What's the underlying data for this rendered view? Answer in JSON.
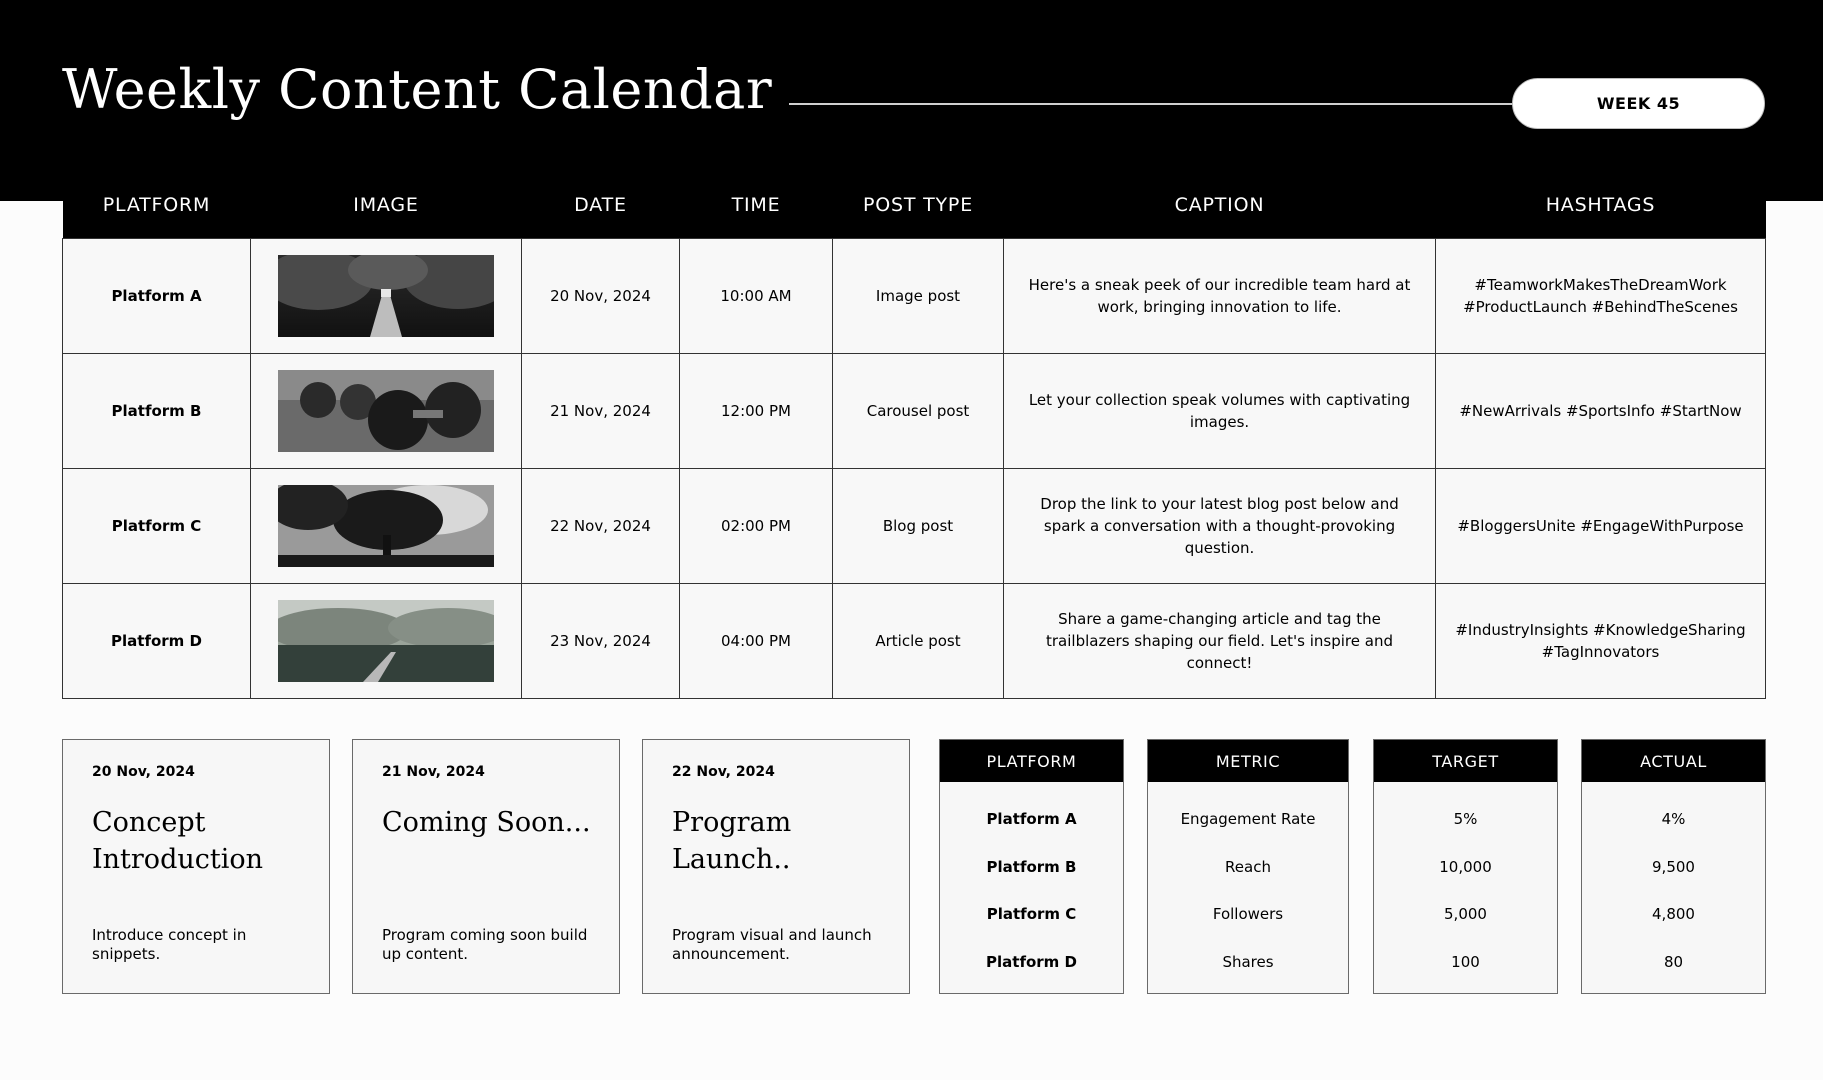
{
  "header": {
    "title": "Weekly Content Calendar",
    "week": "WEEK 45"
  },
  "table": {
    "columns": [
      "PLATFORM",
      "IMAGE",
      "DATE",
      "TIME",
      "POST TYPE",
      "CAPTION",
      "HASHTAGS"
    ],
    "rows": [
      {
        "platform": "Platform A",
        "image": "forest-boardwalk-photo",
        "date": "20 Nov, 2024",
        "time": "10:00 AM",
        "post_type": "Image post",
        "caption": "Here's a sneak peek of our incredible team hard at work, bringing innovation to life.",
        "hashtags": "#TeamworkMakesTheDreamWork #ProductLaunch #BehindTheScenes"
      },
      {
        "platform": "Platform B",
        "image": "dumbbells-photo",
        "date": "21 Nov, 2024",
        "time": "12:00 PM",
        "post_type": "Carousel post",
        "caption": "Let your collection speak volumes with captivating images.",
        "hashtags": "#NewArrivals #SportsInfo #StartNow"
      },
      {
        "platform": "Platform C",
        "image": "tree-silhouette-photo",
        "date": "22 Nov, 2024",
        "time": "02:00 PM",
        "post_type": "Blog post",
        "caption": "Drop the link to your latest blog post below and spark a conversation with a thought-provoking question.",
        "hashtags": "#BloggersUnite #EngageWithPurpose"
      },
      {
        "platform": "Platform D",
        "image": "marsh-walkway-photo",
        "date": "23 Nov, 2024",
        "time": "04:00 PM",
        "post_type": "Article post",
        "caption": "Share a game-changing article and tag the trailblazers shaping our field. Let's inspire and connect!",
        "hashtags": "#IndustryInsights #KnowledgeSharing #TagInnovators"
      }
    ]
  },
  "cards": [
    {
      "date": "20 Nov, 2024",
      "title": "Concept Introduction",
      "desc": "Introduce concept in snippets."
    },
    {
      "date": "21 Nov, 2024",
      "title": "Coming Soon...",
      "desc": "Program coming soon build up content."
    },
    {
      "date": "22 Nov, 2024",
      "title": "Program Launch..",
      "desc": "Program visual and launch announcement."
    }
  ],
  "kpi": {
    "headers": {
      "platform": "PLATFORM",
      "metric": "METRIC",
      "target": "TARGET",
      "actual": "ACTUAL"
    },
    "rows": [
      {
        "platform": "Platform A",
        "metric": "Engagement Rate",
        "target": "5%",
        "actual": "4%"
      },
      {
        "platform": "Platform B",
        "metric": "Reach",
        "target": "10,000",
        "actual": "9,500"
      },
      {
        "platform": "Platform C",
        "metric": "Followers",
        "target": "5,000",
        "actual": "4,800"
      },
      {
        "platform": "Platform D",
        "metric": "Shares",
        "target": "100",
        "actual": "80"
      }
    ]
  }
}
